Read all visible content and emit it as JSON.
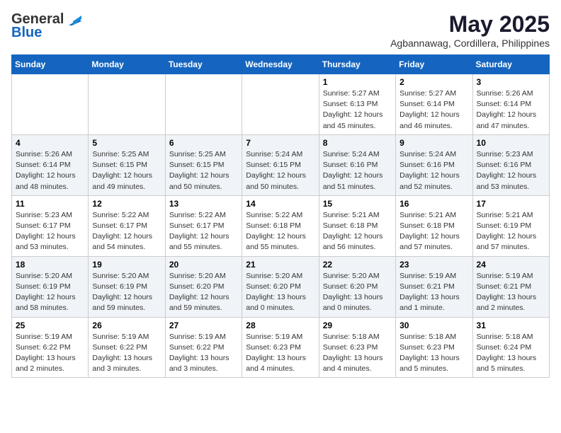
{
  "header": {
    "logo_general": "General",
    "logo_blue": "Blue",
    "month_year": "May 2025",
    "location": "Agbannawag, Cordillera, Philippines"
  },
  "weekdays": [
    "Sunday",
    "Monday",
    "Tuesday",
    "Wednesday",
    "Thursday",
    "Friday",
    "Saturday"
  ],
  "weeks": [
    [
      {
        "day": "",
        "info": ""
      },
      {
        "day": "",
        "info": ""
      },
      {
        "day": "",
        "info": ""
      },
      {
        "day": "",
        "info": ""
      },
      {
        "day": "1",
        "info": "Sunrise: 5:27 AM\nSunset: 6:13 PM\nDaylight: 12 hours\nand 45 minutes."
      },
      {
        "day": "2",
        "info": "Sunrise: 5:27 AM\nSunset: 6:14 PM\nDaylight: 12 hours\nand 46 minutes."
      },
      {
        "day": "3",
        "info": "Sunrise: 5:26 AM\nSunset: 6:14 PM\nDaylight: 12 hours\nand 47 minutes."
      }
    ],
    [
      {
        "day": "4",
        "info": "Sunrise: 5:26 AM\nSunset: 6:14 PM\nDaylight: 12 hours\nand 48 minutes."
      },
      {
        "day": "5",
        "info": "Sunrise: 5:25 AM\nSunset: 6:15 PM\nDaylight: 12 hours\nand 49 minutes."
      },
      {
        "day": "6",
        "info": "Sunrise: 5:25 AM\nSunset: 6:15 PM\nDaylight: 12 hours\nand 50 minutes."
      },
      {
        "day": "7",
        "info": "Sunrise: 5:24 AM\nSunset: 6:15 PM\nDaylight: 12 hours\nand 50 minutes."
      },
      {
        "day": "8",
        "info": "Sunrise: 5:24 AM\nSunset: 6:16 PM\nDaylight: 12 hours\nand 51 minutes."
      },
      {
        "day": "9",
        "info": "Sunrise: 5:24 AM\nSunset: 6:16 PM\nDaylight: 12 hours\nand 52 minutes."
      },
      {
        "day": "10",
        "info": "Sunrise: 5:23 AM\nSunset: 6:16 PM\nDaylight: 12 hours\nand 53 minutes."
      }
    ],
    [
      {
        "day": "11",
        "info": "Sunrise: 5:23 AM\nSunset: 6:17 PM\nDaylight: 12 hours\nand 53 minutes."
      },
      {
        "day": "12",
        "info": "Sunrise: 5:22 AM\nSunset: 6:17 PM\nDaylight: 12 hours\nand 54 minutes."
      },
      {
        "day": "13",
        "info": "Sunrise: 5:22 AM\nSunset: 6:17 PM\nDaylight: 12 hours\nand 55 minutes."
      },
      {
        "day": "14",
        "info": "Sunrise: 5:22 AM\nSunset: 6:18 PM\nDaylight: 12 hours\nand 55 minutes."
      },
      {
        "day": "15",
        "info": "Sunrise: 5:21 AM\nSunset: 6:18 PM\nDaylight: 12 hours\nand 56 minutes."
      },
      {
        "day": "16",
        "info": "Sunrise: 5:21 AM\nSunset: 6:18 PM\nDaylight: 12 hours\nand 57 minutes."
      },
      {
        "day": "17",
        "info": "Sunrise: 5:21 AM\nSunset: 6:19 PM\nDaylight: 12 hours\nand 57 minutes."
      }
    ],
    [
      {
        "day": "18",
        "info": "Sunrise: 5:20 AM\nSunset: 6:19 PM\nDaylight: 12 hours\nand 58 minutes."
      },
      {
        "day": "19",
        "info": "Sunrise: 5:20 AM\nSunset: 6:19 PM\nDaylight: 12 hours\nand 59 minutes."
      },
      {
        "day": "20",
        "info": "Sunrise: 5:20 AM\nSunset: 6:20 PM\nDaylight: 12 hours\nand 59 minutes."
      },
      {
        "day": "21",
        "info": "Sunrise: 5:20 AM\nSunset: 6:20 PM\nDaylight: 13 hours\nand 0 minutes."
      },
      {
        "day": "22",
        "info": "Sunrise: 5:20 AM\nSunset: 6:20 PM\nDaylight: 13 hours\nand 0 minutes."
      },
      {
        "day": "23",
        "info": "Sunrise: 5:19 AM\nSunset: 6:21 PM\nDaylight: 13 hours\nand 1 minute."
      },
      {
        "day": "24",
        "info": "Sunrise: 5:19 AM\nSunset: 6:21 PM\nDaylight: 13 hours\nand 2 minutes."
      }
    ],
    [
      {
        "day": "25",
        "info": "Sunrise: 5:19 AM\nSunset: 6:22 PM\nDaylight: 13 hours\nand 2 minutes."
      },
      {
        "day": "26",
        "info": "Sunrise: 5:19 AM\nSunset: 6:22 PM\nDaylight: 13 hours\nand 3 minutes."
      },
      {
        "day": "27",
        "info": "Sunrise: 5:19 AM\nSunset: 6:22 PM\nDaylight: 13 hours\nand 3 minutes."
      },
      {
        "day": "28",
        "info": "Sunrise: 5:19 AM\nSunset: 6:23 PM\nDaylight: 13 hours\nand 4 minutes."
      },
      {
        "day": "29",
        "info": "Sunrise: 5:18 AM\nSunset: 6:23 PM\nDaylight: 13 hours\nand 4 minutes."
      },
      {
        "day": "30",
        "info": "Sunrise: 5:18 AM\nSunset: 6:23 PM\nDaylight: 13 hours\nand 5 minutes."
      },
      {
        "day": "31",
        "info": "Sunrise: 5:18 AM\nSunset: 6:24 PM\nDaylight: 13 hours\nand 5 minutes."
      }
    ]
  ]
}
